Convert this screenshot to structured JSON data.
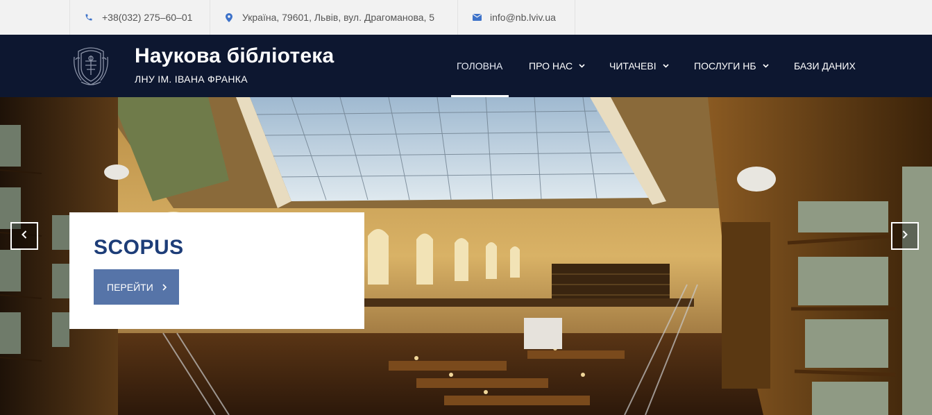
{
  "topbar": {
    "phone": "+38(032) 275–60–01",
    "address": "Україна, 79601, Львів, вул. Драгоманова, 5",
    "email": "info@nb.lviv.ua",
    "icons": {
      "phone": "phone-icon",
      "address": "map-marker-icon",
      "email": "envelope-icon"
    },
    "icon_color": "#3d72c9"
  },
  "header": {
    "title": "Наукова бібліотека",
    "subtitle": "ЛНУ ІМ. ІВАНА ФРАНКА",
    "logo_icon": "university-crest-icon",
    "background": "#0d1730"
  },
  "nav": {
    "items": [
      {
        "label": "ГОЛОВНА",
        "has_dropdown": false,
        "active": true
      },
      {
        "label": "ПРО НАС",
        "has_dropdown": true,
        "active": false
      },
      {
        "label": "ЧИТАЧЕВІ",
        "has_dropdown": true,
        "active": false
      },
      {
        "label": "ПОСЛУГИ НБ",
        "has_dropdown": true,
        "active": false
      },
      {
        "label": "БАЗИ ДАНИХ",
        "has_dropdown": false,
        "active": false
      }
    ]
  },
  "slider": {
    "slide_title": "SCOPUS",
    "button_label": "ПЕРЕЙТИ",
    "button_icon": "chevron-right-icon",
    "prev_icon": "chevron-left-icon",
    "next_icon": "chevron-right-icon",
    "title_color": "#1d3d78",
    "button_color": "#5674a8"
  }
}
